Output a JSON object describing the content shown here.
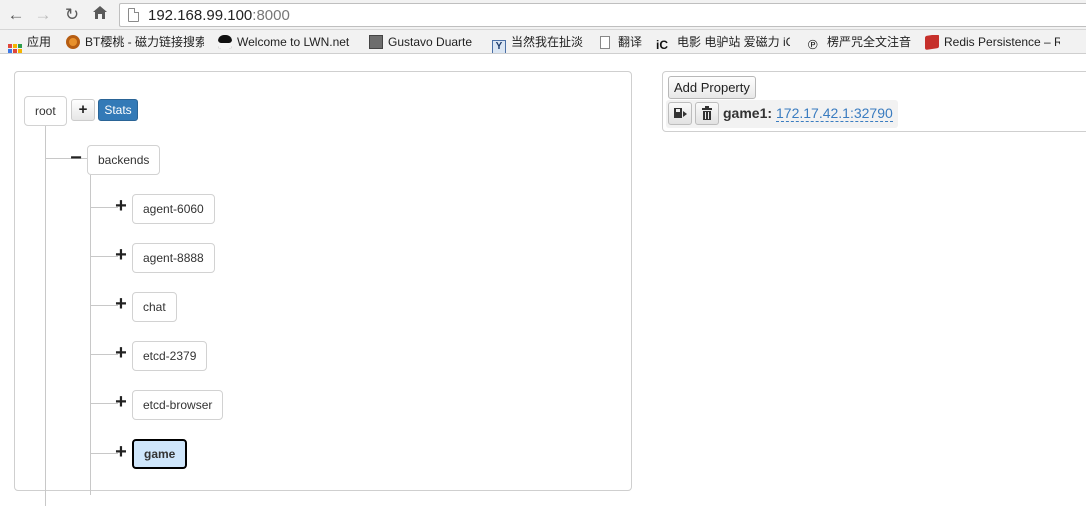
{
  "browser": {
    "url_host": "192.168.99.100",
    "url_port": ":8000",
    "bookmarks": [
      {
        "label": "应用",
        "icon": "apps-grid-icon"
      },
      {
        "label": "BT樱桃 - 磁力链接搜索",
        "icon": "orange-circle-icon"
      },
      {
        "label": "Welcome to LWN.net",
        "icon": "penguin-icon"
      },
      {
        "label": "Gustavo Duarte",
        "icon": "portrait-icon"
      },
      {
        "label": "当然我在扯淡",
        "icon": "y-logo-icon"
      },
      {
        "label": "翻译",
        "icon": "page-icon"
      },
      {
        "label": "电影 电驴站 爱磁力 iC",
        "icon": "ic-logo-icon"
      },
      {
        "label": "楞严咒全文注音",
        "icon": "calligraphy-icon"
      },
      {
        "label": "Redis Persistence – R",
        "icon": "redis-icon"
      }
    ]
  },
  "tree": {
    "root": {
      "label": "root",
      "add_label": "+",
      "stats_label": "Stats"
    },
    "backends": {
      "label": "backends",
      "toggle": "−"
    },
    "children": [
      {
        "label": "agent-6060",
        "toggle": "+"
      },
      {
        "label": "agent-8888",
        "toggle": "+"
      },
      {
        "label": "chat",
        "toggle": "+"
      },
      {
        "label": "etcd-2379",
        "toggle": "+"
      },
      {
        "label": "etcd-browser",
        "toggle": "+"
      },
      {
        "label": "game",
        "toggle": "+",
        "selected": true
      }
    ]
  },
  "properties": {
    "add_label": "Add Property",
    "items": [
      {
        "key": "game1:",
        "value": "172.17.42.1:32790"
      }
    ]
  },
  "colors": {
    "accent": "#337ab7",
    "link": "#3a7cc0",
    "selected_bg": "#cfe6fb"
  }
}
